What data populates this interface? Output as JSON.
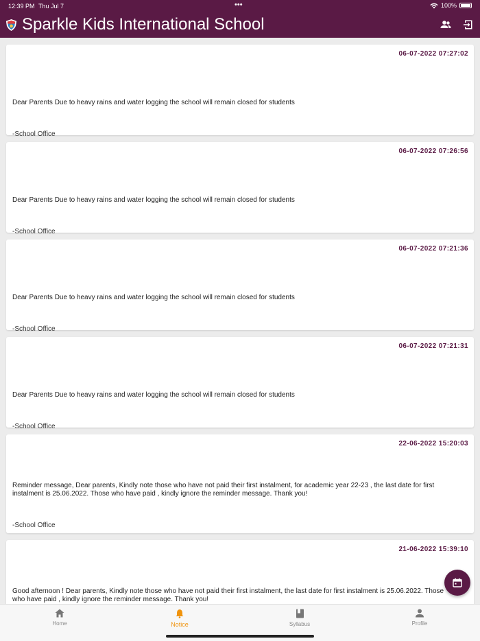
{
  "status_bar": {
    "time": "12:39 PM",
    "date": "Thu Jul 7",
    "dots": "•••",
    "battery": "100%"
  },
  "app": {
    "title": "Sparkle Kids International School"
  },
  "notices": [
    {
      "date": "06-07-2022 07:27:02",
      "message": "Dear Parents  Due to heavy rains and water logging the school will remain closed for students",
      "signature": "-School Office"
    },
    {
      "date": "06-07-2022 07:26:56",
      "message": "Dear Parents  Due to heavy rains and water logging the school will remain closed for students",
      "signature": "-School Office"
    },
    {
      "date": "06-07-2022 07:21:36",
      "message": "Dear Parents  Due to heavy rains and water logging the school will remain closed for students",
      "signature": "-School Office"
    },
    {
      "date": "06-07-2022 07:21:31",
      "message": "Dear Parents  Due to heavy rains and water logging the school will remain closed for students",
      "signature": "-School Office"
    },
    {
      "date": "22-06-2022 15:20:03",
      "message": "Reminder message,    Dear parents,    Kindly note those who have not paid their first instalment, for academic year 22-23 , the last date for first instalment is 25.06.2022.  Those who have paid , kindly ignore the reminder message.  Thank you!",
      "signature": "-School Office"
    },
    {
      "date": "21-06-2022 15:39:10",
      "message": "Good afternoon !  Dear parents,    Kindly note those who have not paid their first instalment, the last date for first instalment is 25.06.2022.  Those who have paid , kindly ignore the reminder message.  Thank you!",
      "signature": ""
    }
  ],
  "nav": {
    "home": "Home",
    "notice": "Notice",
    "syllabus": "Syllabus",
    "profile": "Profile"
  },
  "colors": {
    "brand": "#5a1a45",
    "active_tab": "#f0930c"
  },
  "icons": [
    "school-logo-icon",
    "switch-user-icon",
    "logout-icon",
    "calendar-icon",
    "home-icon",
    "bell-icon",
    "book-icon",
    "person-icon"
  ]
}
